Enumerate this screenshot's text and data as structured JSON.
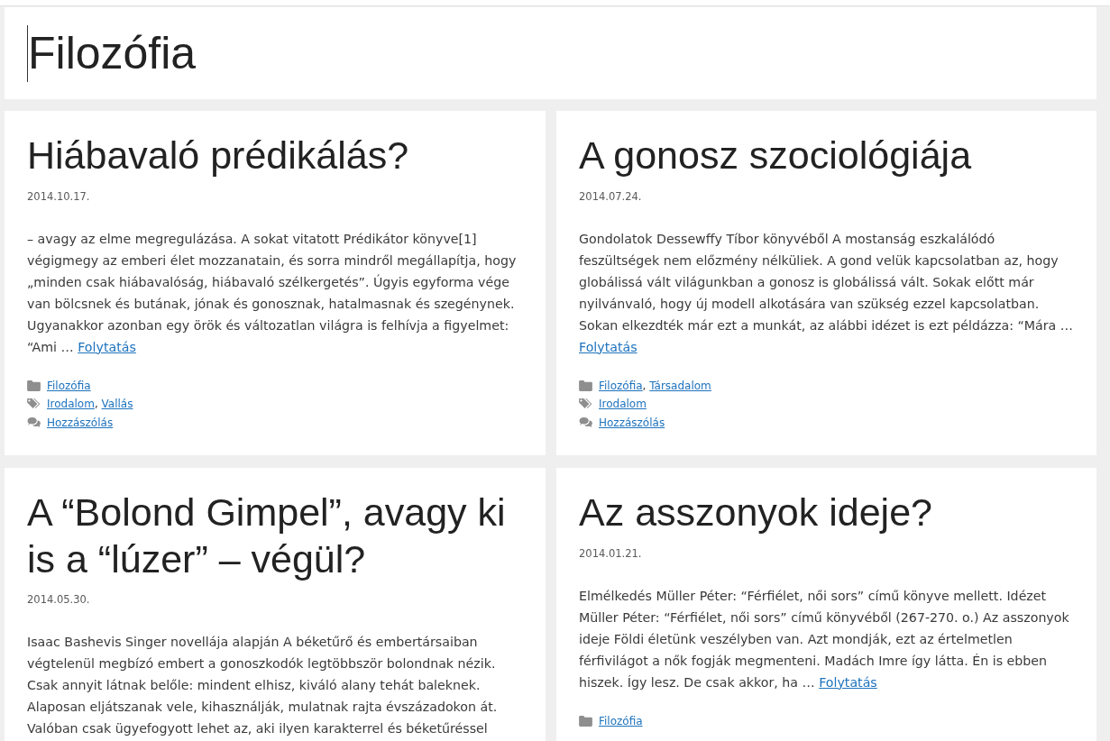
{
  "page_title": "Filozófia",
  "meta_separator": ",",
  "posts": [
    {
      "title": "Hiábavaló prédikálás?",
      "date": "2014.10.17.",
      "excerpt": "– avagy az elme megregulázása. A sokat vitatott Prédikátor könyve[1] végigmegy az emberi élet mozzanatain, és sorra mindről megállapítja, hogy „minden csak hiábavalóság, hiábavaló szélkergetés”. Úgyis egyforma vége van bölcsnek és butának, jónak és gonosznak, hatalmasnak és szegénynek. Ugyanakkor azonban egy örök és változatlan világra is felhívja a figyelmet: “Ami …",
      "more_link": "Folytatás",
      "categories": [
        "Filozófia"
      ],
      "tags": [
        "Irodalom",
        "Vallás"
      ],
      "comments_link": "Hozzászólás"
    },
    {
      "title": "A gonosz szociológiája",
      "date": "2014.07.24.",
      "excerpt": "Gondolatok Dessewffy Tíbor könyvéből A mostanság eszkalálódó feszültségek nem előzmény nélküliek. A gond velük kapcsolatban az, hogy globálissá vált világunkban a gonosz is globálissá vált. Sokak előtt már nyilvánvaló, hogy új modell alkotására van szükség ezzel kapcsolatban. Sokan elkezdték már ezt a munkát, az alábbi idézet is ezt példázza: “Mára …",
      "more_link": "Folytatás",
      "categories": [
        "Filozófia",
        "Társadalom"
      ],
      "tags": [
        "Irodalom"
      ],
      "comments_link": "Hozzászólás"
    },
    {
      "title": "A “Bolond Gimpel”, avagy ki is a “lúzer” – végül?",
      "date": "2014.05.30.",
      "excerpt": "Isaac Bashevis Singer novellája alapján A béketűrő és embertársaiban végtelenül megbízó embert a gonoszkodók legtöbbször bolondnak nézik. Csak annyit látnak belőle: mindent elhisz, kiváló alany tehát baleknek. Alaposan eljátszanak vele, kihasználják, mulatnak rajta évszázadokon át. Valóban csak ügyefogyott lehet az, aki ilyen karakterrel és béketűréssel"
    },
    {
      "title": "Az asszonyok ideje?",
      "date": "2014.01.21.",
      "excerpt": "Elmélkedés Müller Péter: “Férfiélet, női sors” című könyve mellett. Idézet Müller Péter: “Férfiélet, női sors” című könyvéből (267-270. o.) Az asszonyok ideje Földi életünk veszélyben van. Azt mondják, ezt az értelmetlen férfivilágot a nők fogják megmenteni. Madách Imre így látta. Én is ebben hiszek. Így lesz. De csak akkor, ha …",
      "more_link": "Folytatás",
      "categories": [
        "Filozófia"
      ]
    }
  ]
}
